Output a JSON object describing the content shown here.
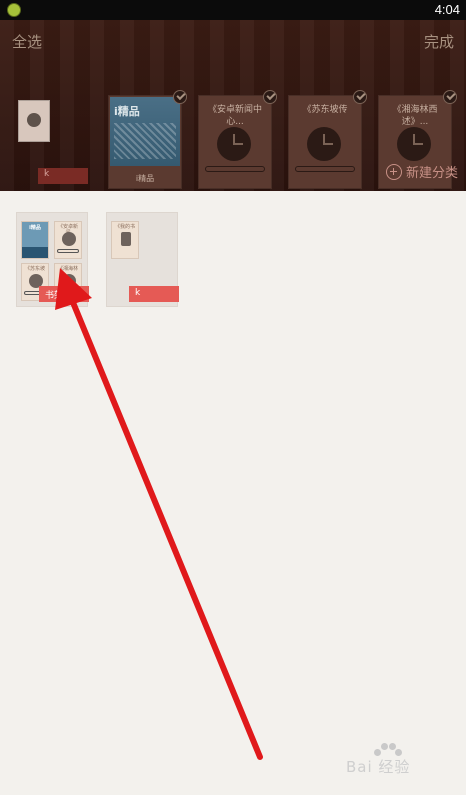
{
  "status_bar": {
    "time": "4:04"
  },
  "top_bar": {
    "select_all": "全选",
    "done": "完成"
  },
  "shelf": {
    "books": [
      {
        "title": "",
        "style": "icon"
      },
      {
        "title": "",
        "cover_brand": "i精品",
        "bottom_label": "i精品",
        "style": "cover"
      },
      {
        "title": "《安卓新闻中心...",
        "style": "clock"
      },
      {
        "title": "《苏东坡传",
        "style": "clock"
      },
      {
        "title": "《湘海林西述》...",
        "style": "clock"
      }
    ],
    "category_tag": "k",
    "new_category": "新建分类"
  },
  "folders": [
    {
      "name": "书架",
      "tag": "书架",
      "minis": [
        {
          "label": "i精品",
          "kind": "blue"
        },
        {
          "label": "《安卓新闻",
          "kind": "clock"
        },
        {
          "label": "《苏东坡",
          "kind": "clock"
        },
        {
          "label": "《湘海林",
          "kind": "clock"
        }
      ]
    },
    {
      "name": "k",
      "tag": "k",
      "minis": [
        {
          "label": "《我的书",
          "kind": "clock"
        }
      ]
    }
  ],
  "watermark": {
    "text": "Bai 经验"
  },
  "colors": {
    "accent_red": "#e55a55",
    "arrow_red": "#e0191b",
    "overlay_dark": "#2f160f"
  }
}
